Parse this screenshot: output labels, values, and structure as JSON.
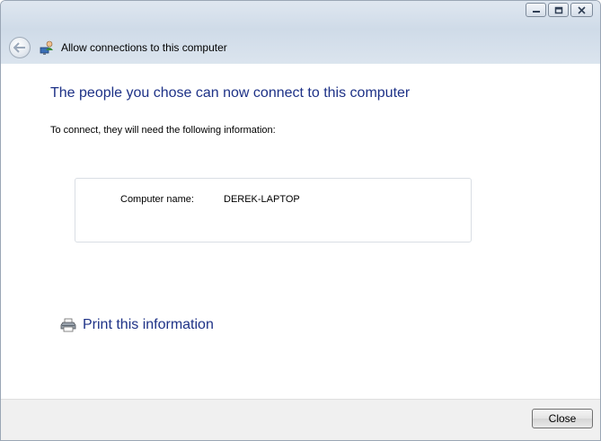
{
  "window": {
    "title": "Allow connections to this computer"
  },
  "main": {
    "heading": "The people you chose can now connect to this computer",
    "instruction": "To connect, they will need the following information:",
    "info": {
      "label": "Computer name:",
      "value": "DEREK-LAPTOP"
    },
    "print_link": "Print this information"
  },
  "footer": {
    "close_label": "Close"
  },
  "icons": {
    "back": "back-arrow-icon",
    "app": "network-users-icon",
    "print": "printer-icon",
    "minimize": "minimize-icon",
    "maximize": "maximize-icon",
    "close": "close-icon"
  },
  "colors": {
    "heading": "#1e3287",
    "link": "#1e3287",
    "titlebar": "#d5dfea",
    "footer": "#f0f0f0"
  }
}
